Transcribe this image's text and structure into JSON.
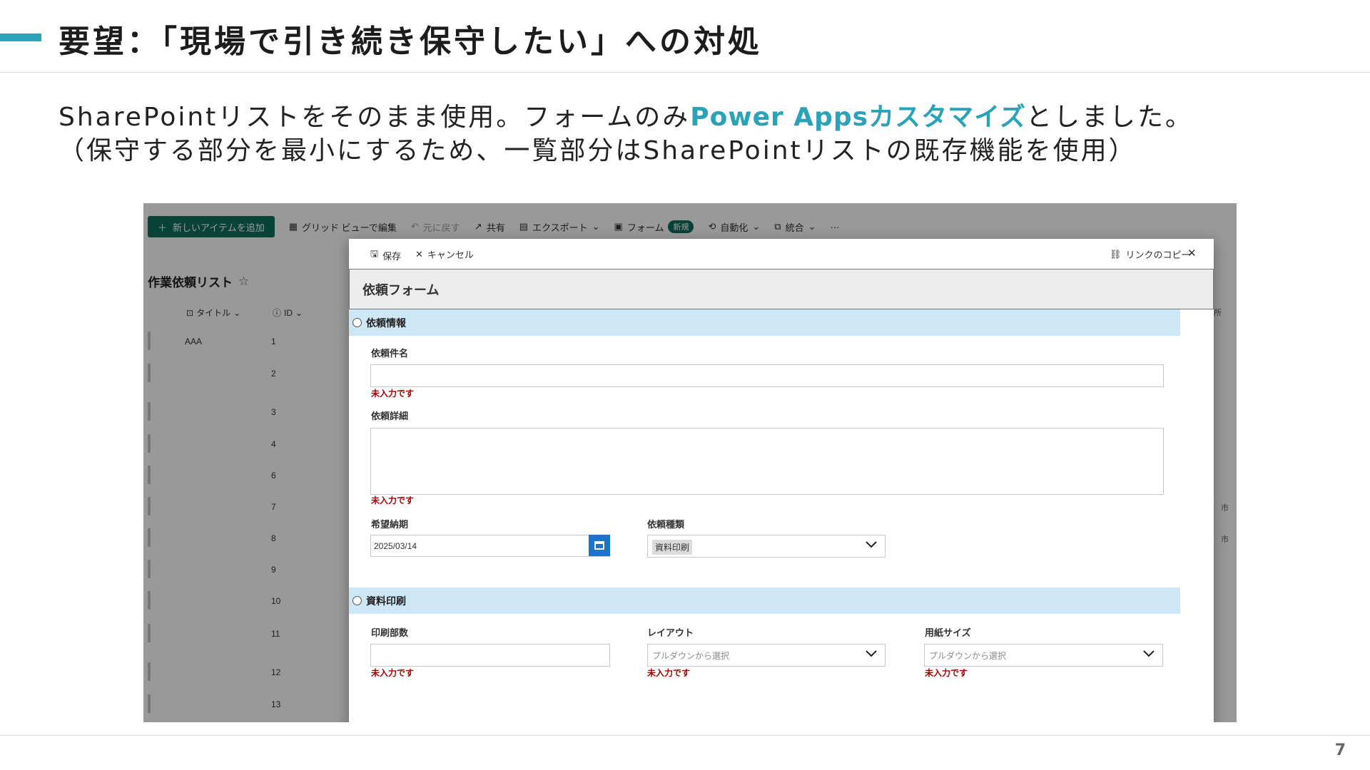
{
  "slide": {
    "title": "要望：「現場で引き続き保守したい」への対処",
    "line1_pre": "SharePointリストをそのまま使用。フォームのみ",
    "line1_highlight": "Power Appsカスタマイズ",
    "line1_post": "としました。",
    "line2": "（保守する部分を最小にするため、一覧部分はSharePointリストの既存機能を使用）",
    "page_number": "7",
    "accent_color": "#2aa3b8"
  },
  "sharepoint": {
    "toolbar": {
      "new_item": "新しいアイテムを追加",
      "grid_edit": "グリッド ビューで編集",
      "undo": "元に戻す",
      "share": "共有",
      "export": "エクスポート",
      "forms": "フォーム",
      "forms_badge": "新規",
      "automate": "自動化",
      "integrate": "統合",
      "more": "···"
    },
    "list_title": "作業依頼リスト",
    "columns": {
      "title": "タイトル",
      "id": "ID"
    },
    "rows": [
      {
        "title": "AAA",
        "id": "1"
      },
      {
        "title": "",
        "id": "2"
      },
      {
        "title": "",
        "id": "3"
      },
      {
        "title": "",
        "id": "4"
      },
      {
        "title": "",
        "id": "6"
      },
      {
        "title": "",
        "id": "7"
      },
      {
        "title": "",
        "id": "8"
      },
      {
        "title": "",
        "id": "9"
      },
      {
        "title": "",
        "id": "10"
      },
      {
        "title": "",
        "id": "11"
      },
      {
        "title": "",
        "id": "12"
      },
      {
        "title": "",
        "id": "13"
      }
    ],
    "right_peek": {
      "header": "所",
      "row7": "市",
      "row8": "市"
    }
  },
  "form": {
    "save": "保存",
    "cancel": "キャンセル",
    "copy_link": "リンクのコピー",
    "title": "依頼フォーム",
    "section1": "依頼情報",
    "request_name_label": "依頼件名",
    "request_detail_label": "依頼詳細",
    "due_label": "希望納期",
    "due_value": "2025/03/14",
    "type_label": "依頼種類",
    "type_value": "資料印刷",
    "section2": "資料印刷",
    "copies_label": "印刷部数",
    "layout_label": "レイアウト",
    "paper_label": "用紙サイズ",
    "dropdown_placeholder": "プルダウンから選択",
    "error_text": "未入力です",
    "section_color": "#cde7f6",
    "error_color": "#a50000"
  }
}
